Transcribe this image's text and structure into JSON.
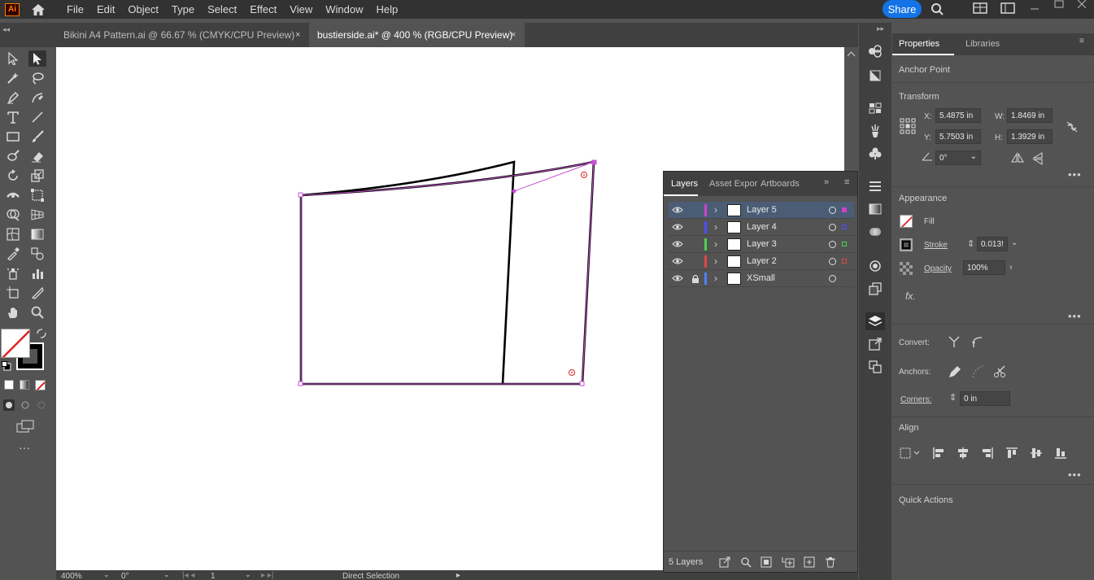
{
  "app": {
    "logo": "Ai"
  },
  "menu": [
    "File",
    "Edit",
    "Object",
    "Type",
    "Select",
    "Effect",
    "View",
    "Window",
    "Help"
  ],
  "share_label": "Share",
  "tabs": [
    {
      "label": "Bikini A4 Pattern.ai @ 66.67 % (CMYK/CPU Preview)"
    },
    {
      "label": "bustierside.ai* @ 400 % (RGB/CPU Preview)"
    }
  ],
  "tab_close": "×",
  "status": {
    "zoom": "400%",
    "rotate": "0°",
    "artboard": "1",
    "tool": "Direct Selection"
  },
  "layers_panel": {
    "tabs": [
      "Layers",
      "Asset Expor",
      "Artboards"
    ],
    "rows": [
      {
        "name": "Layer 5",
        "color": "#cc44cc",
        "locked": false,
        "selected": true,
        "sel_color": "#cc44cc"
      },
      {
        "name": "Layer 4",
        "color": "#4f4fff",
        "locked": false,
        "selected": false,
        "sel_color": "#4f4fff"
      },
      {
        "name": "Layer 3",
        "color": "#4fd04f",
        "locked": false,
        "selected": false,
        "sel_color": "#4fd04f"
      },
      {
        "name": "Layer 2",
        "color": "#e04848",
        "locked": false,
        "selected": false,
        "sel_color": "#e04848"
      },
      {
        "name": "XSmall",
        "color": "#4f7fff",
        "locked": true,
        "selected": false,
        "sel_color": ""
      }
    ],
    "count": "5 Layers"
  },
  "properties": {
    "tabs": [
      "Properties",
      "Libraries"
    ],
    "selection": "Anchor Point",
    "transform": {
      "title": "Transform",
      "x_label": "X:",
      "x": "5.4875 in",
      "y_label": "Y:",
      "y": "5.7503 in",
      "w_label": "W:",
      "w": "1.8469 in",
      "h_label": "H:",
      "h": "1.3929 in",
      "angle": "0°"
    },
    "appearance": {
      "title": "Appearance",
      "fill": "Fill",
      "stroke": "Stroke",
      "stroke_value": "0.013!",
      "opacity": "Opacity",
      "opacity_value": "100%",
      "fx": "fx."
    },
    "convert_label": "Convert:",
    "anchors_label": "Anchors:",
    "corners_label": "Corners:",
    "corners_value": "0 in",
    "align_title": "Align",
    "quick_actions": "Quick Actions"
  },
  "colors": {
    "accent": "#1473e6",
    "selection_path": "#c84fd0",
    "panel": "#535353",
    "dark": "#323232"
  }
}
